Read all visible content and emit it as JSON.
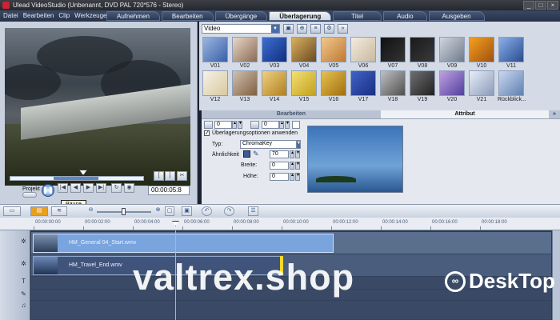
{
  "window": {
    "title": "Ulead VideoStudio (Unbenannt, DVD PAL 720*576 - Stereo)",
    "controls": [
      "_",
      "□",
      "×"
    ]
  },
  "menu": [
    "Datei",
    "Bearbeiten",
    "Clip",
    "Werkzeuge"
  ],
  "steps": [
    {
      "label": "Aufnehmen"
    },
    {
      "label": "Bearbeiten"
    },
    {
      "label": "Übergänge"
    },
    {
      "label": "Überlagerung",
      "active": true
    },
    {
      "label": "Titel"
    },
    {
      "label": "Audio"
    },
    {
      "label": "Ausgeben"
    }
  ],
  "preview": {
    "projekt_label": "Projekt",
    "timecode": "00:00:05:8",
    "tooltip": "Pause"
  },
  "library": {
    "category": "Video",
    "thumbs": [
      "V01",
      "V02",
      "V03",
      "V04",
      "V05",
      "V06",
      "V07",
      "V08",
      "V09",
      "V10",
      "V11",
      "V12",
      "V13",
      "V14",
      "V15",
      "V16",
      "V17",
      "V18",
      "V19",
      "V20",
      "V21",
      "Rückblick..."
    ]
  },
  "subtabs": {
    "left": "Bearbeiten",
    "right": "Attribut"
  },
  "attributes": {
    "spin1": "0",
    "spin2": "0",
    "overlay_option": "Überlagerungsoptionen anwenden",
    "typ_label": "Typ:",
    "typ_value": "ChromaKey",
    "similarity_label": "Ähnlichkeit",
    "similarity_value": "70",
    "width_label": "Breite:",
    "width_value": "0",
    "height_label": "Höhe:",
    "height_value": "0"
  },
  "timeline": {
    "ruler": [
      "00:00:00:00",
      "00:00:02:00",
      "00:00:04:00",
      "00:00:06:00",
      "00:00:08:00",
      "00:00:10:00",
      "00:00:12:00",
      "00:00:14:00",
      "00:00:16:00",
      "00:00:18:00"
    ],
    "clips": {
      "video": "HM_General 04_Start.wmv",
      "overlay": "HM_Travel_End.wmv"
    },
    "track_icons": [
      "film-track-icon",
      "overlay-track-icon",
      "title-track-icon",
      "voice-track-icon",
      "music-track-icon"
    ]
  },
  "watermark": {
    "text": "valtrex.shop",
    "logo": "DeskTop",
    "logo_prefix": "D"
  }
}
